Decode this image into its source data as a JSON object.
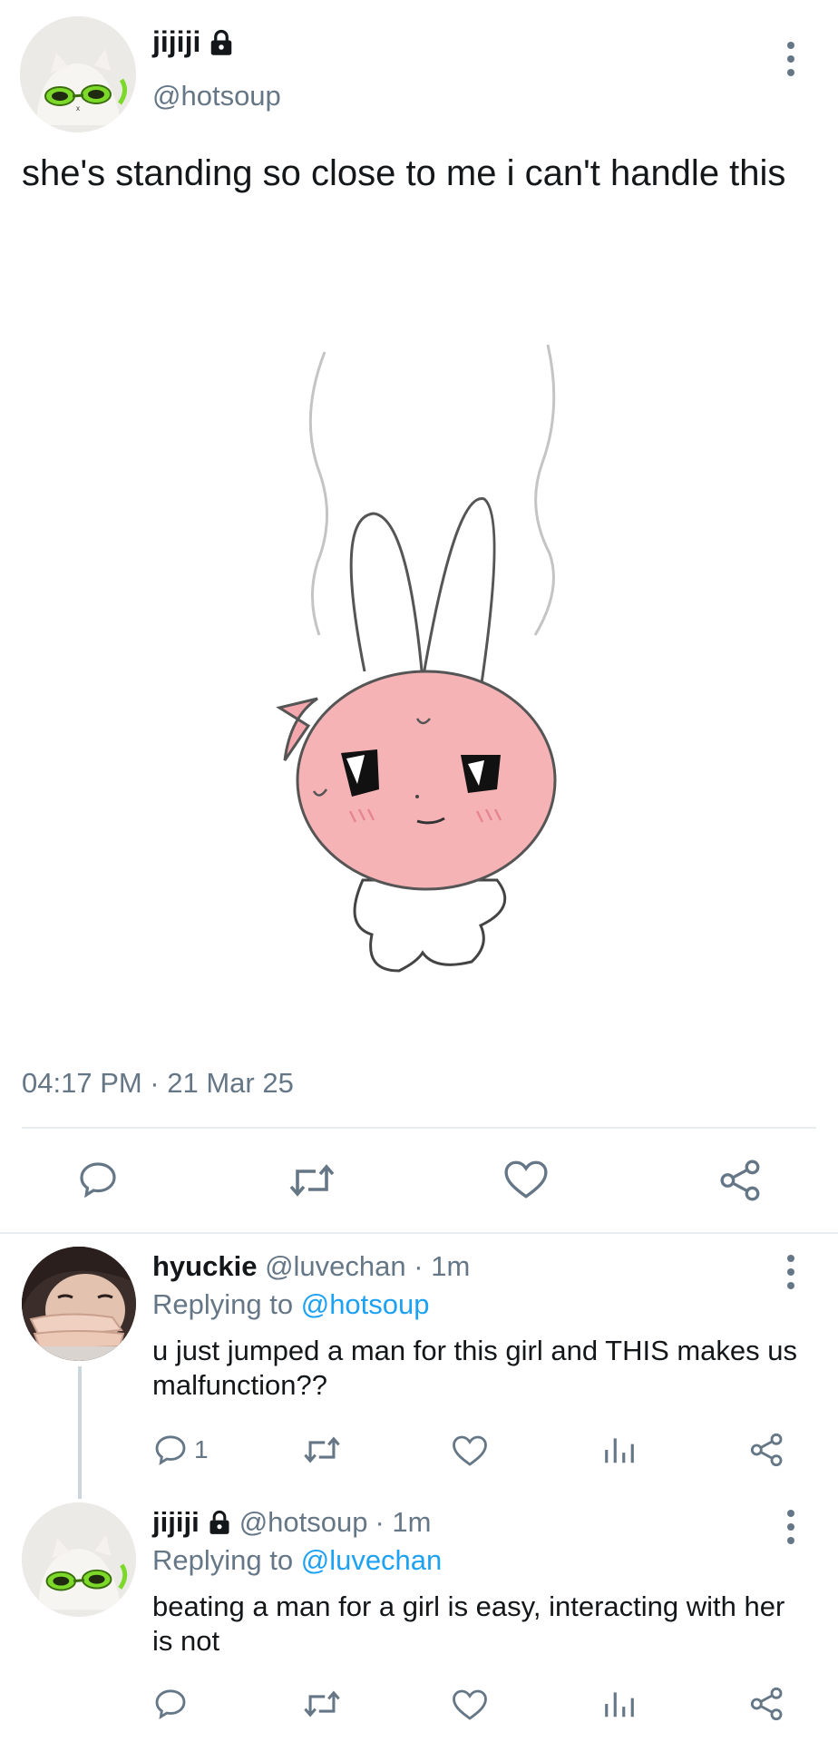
{
  "tweet": {
    "author_name": "jijiji",
    "handle": "@hotsoup",
    "text": "she's standing so close to me i can't handle this",
    "timestamp": "04:17 PM · 21 Mar 25",
    "image_icon": "pink-bunny-sticker"
  },
  "replies": [
    {
      "author_name": "hyuckie",
      "handle": "@luvechan",
      "time": "· 1m",
      "replying_prefix": "Replying to",
      "replying_handle": "@hotsoup",
      "text": "u just jumped a man for this girl and THIS makes us malfunction??",
      "reply_count": "1"
    },
    {
      "author_name": "jijiji",
      "handle": "@hotsoup",
      "time": "· 1m",
      "replying_prefix": "Replying to",
      "replying_handle": "@luvechan",
      "text": "beating a man for a girl is easy, interacting with her is not",
      "reply_count": ""
    }
  ],
  "colors": {
    "accent": "#1da1f2",
    "muted": "#657786",
    "divider": "#e6ecf0"
  }
}
